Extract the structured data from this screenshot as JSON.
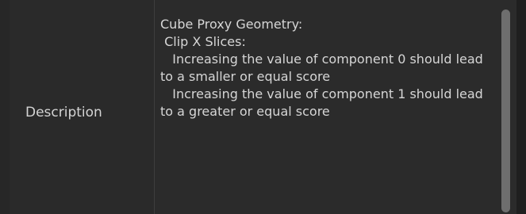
{
  "property_row": {
    "label": "Description",
    "value": "Cube Proxy Geometry:\n Clip X Slices:\n   Increasing the value of component 0 should lead to a smaller or equal score\n   Increasing the value of component 1 should lead to a greater or equal score"
  }
}
